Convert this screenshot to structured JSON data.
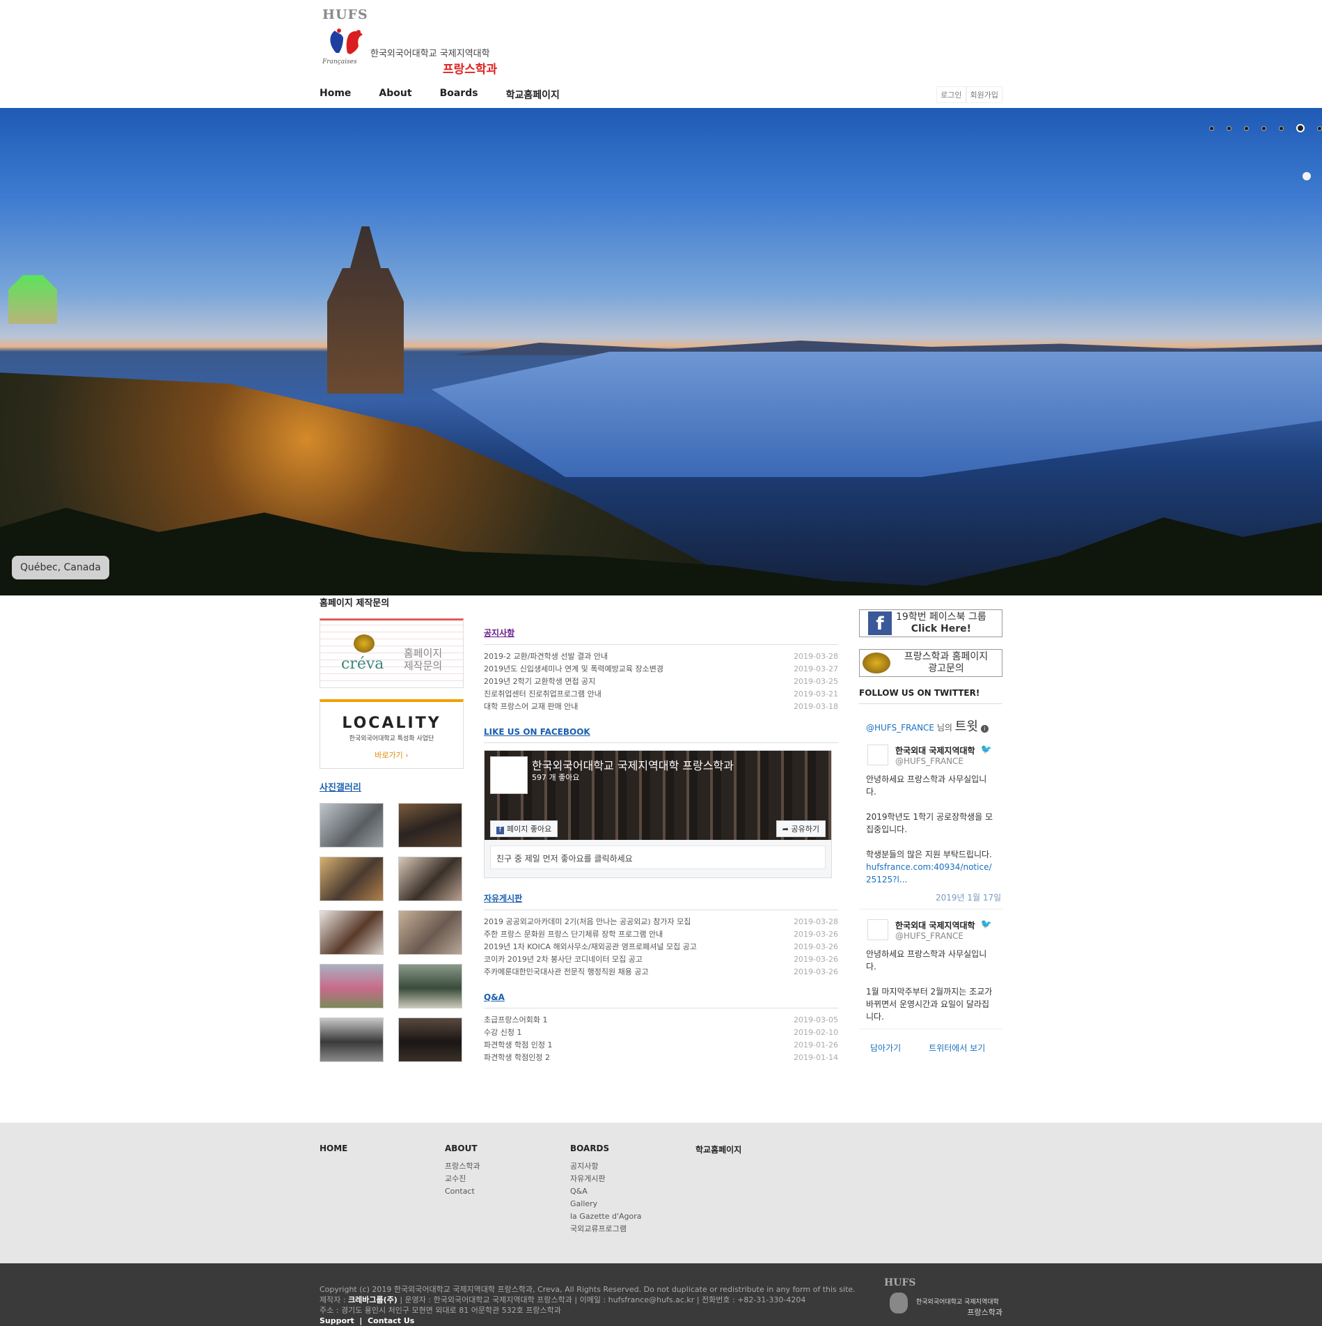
{
  "header": {
    "logo_text": "HUFS",
    "logo_sub": "Françaises",
    "brand_line1": "한국외국어대학교 국제지역대학",
    "brand_line2": "프랑스학과",
    "nav": [
      "Home",
      "About",
      "Boards",
      "학교홈페이지"
    ],
    "login": "로그인",
    "signup": "회원가입"
  },
  "hero": {
    "caption": "Québec, Canada",
    "slide_count": 7,
    "active_slide": 6
  },
  "left": {
    "inquiry_title": "홈페이지 제작문의",
    "creva_logo": "créva",
    "creva_text_1": "홈페이지",
    "creva_text_2": "제작문의",
    "locality_logo": "LOCALITY",
    "locality_sub": "한국외국어대학교 특성화 사업단",
    "locality_go": "바로가기 ›",
    "gallery_title": "사진갤러리"
  },
  "notice": {
    "title": "공지사항",
    "posts": [
      {
        "title": "2019-2 교환/파견학생 선발 결과 안내",
        "date": "2019-03-28"
      },
      {
        "title": "2019년도 신입생세미나 연계 및 폭력예방교육 장소변경",
        "date": "2019-03-27"
      },
      {
        "title": "2019년 2학기 교환학생 면접 공지",
        "date": "2019-03-25"
      },
      {
        "title": "진로취업센터 진로취업프로그램 안내",
        "date": "2019-03-21"
      },
      {
        "title": "대학 프랑스어 교재 판매 안내",
        "date": "2019-03-18"
      }
    ]
  },
  "facebook": {
    "title": "LIKE US ON FACEBOOK",
    "page_name": "한국외국어대학교 국제지역대학 프랑스학과",
    "likes": "597 개 좋아요",
    "like_button": "페이지 좋아요",
    "share_button": "공유하기",
    "friend_text": "친구 중 제일 먼저 좋아요를 클릭하세요"
  },
  "free_board": {
    "title": "자유게시판",
    "posts": [
      {
        "title": "2019 공공외교아카데미 2기(처음 만나는 공공외교) 참가자 모집",
        "date": "2019-03-28"
      },
      {
        "title": "주한 프랑스 문화원 프랑스 단기체류 장학 프로그램 안내",
        "date": "2019-03-26"
      },
      {
        "title": "2019년 1차 KOICA 해외사무소/재외공관 영프로페셔널 모집 공고",
        "date": "2019-03-26"
      },
      {
        "title": "코이카 2019년 2차 봉사단 코디네이터 모집 공고",
        "date": "2019-03-26"
      },
      {
        "title": "주카메룬대한민국대사관 전문직 행정직원 채용 공고",
        "date": "2019-03-26"
      }
    ]
  },
  "qna": {
    "title": "Q&A",
    "posts": [
      {
        "title": "초급프랑스어회화 1",
        "date": "2019-03-05"
      },
      {
        "title": "수강 신청 1",
        "date": "2019-02-10"
      },
      {
        "title": "파견학생 학점 인정 1",
        "date": "2019-01-26"
      },
      {
        "title": "파견학생 학점인정 2",
        "date": "2019-01-14"
      }
    ]
  },
  "right": {
    "fb_group_line1": "19학번 페이스북 그룹",
    "fb_group_line2": "Click Here!",
    "ad_line1": "프랑스학과 홈페이지",
    "ad_line2": "광고문의",
    "follow": "FOLLOW US ON TWITTER!",
    "tw_handle": "@HUFS_FRANCE",
    "tw_suffix": "님의",
    "tw_big": "트윗",
    "tweets": [
      {
        "name": "한국외대 국제지역대학",
        "handle": "@HUFS_FRANCE",
        "body": "안녕하세요 프랑스학과 사무실입니다.\n\n2019학년도 1학기 공로장학생을 모집중입니다.\n\n학생분들의 많은 지원 부탁드립니다.",
        "link": "hufsfrance.com:40934/notice/25125?l...",
        "date": "2019년 1월 17일"
      },
      {
        "name": "한국외대 국제지역대학",
        "handle": "@HUFS_FRANCE",
        "body": "안녕하세요 프랑스학과 사무실입니다.\n\n1월 마지막주부터 2월까지는 조교가 바뀌면서 운영시간과 요일이 달라집니다.",
        "link": "",
        "date": ""
      }
    ],
    "embed": "담아가기",
    "view_on_twitter": "트위터에서 보기"
  },
  "footer_nav": {
    "home": "HOME",
    "about": "ABOUT",
    "about_items": [
      "프랑스학과",
      "교수진",
      "Contact"
    ],
    "boards": "BOARDS",
    "boards_items": [
      "공지사항",
      "자유게시판",
      "Q&A",
      "Gallery",
      "la Gazette d'Agora",
      "국외교류프로그램"
    ],
    "school": "학교홈페이지"
  },
  "bottom": {
    "copyright": "Copyright (c) 2019 한국외국어대학교 국제지역대학 프랑스학과, Creva, All Rights Reserved. Do not duplicate or redistribute in any form of this site.",
    "maker_label": "제작자 :",
    "maker": "크레바그룹(주)",
    "operator": "| 운영자 : 한국외국어대학교 국제지역대학 프랑스학과 | 이메일 : hufsfrance@hufs.ac.kr | 전화번호 : +82-31-330-4204",
    "address": "주소 : 경기도 용인시 처인구 모현면 외대로 81 어문학관 532호 프랑스학과",
    "support": "Support",
    "contact": "Contact Us",
    "logo_text": "HUFS",
    "logo_line1": "한국외국어대학교 국제지역대학",
    "logo_line2": "프랑스학과"
  }
}
